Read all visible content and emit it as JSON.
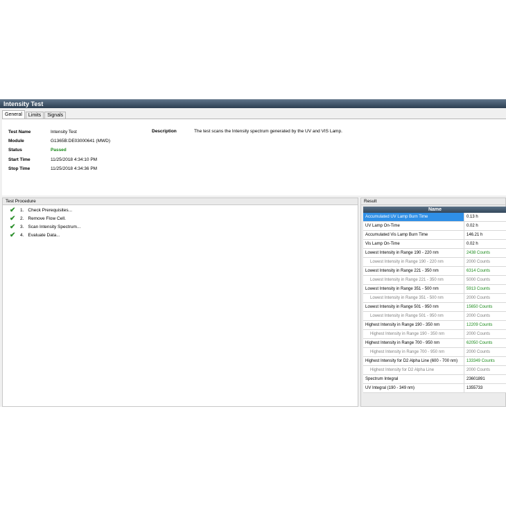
{
  "window": {
    "title": "Intensity Test"
  },
  "tabs": [
    "General",
    "Limits",
    "Signals"
  ],
  "info": {
    "test_name_label": "Test Name",
    "test_name": "Intensity Test",
    "module_label": "Module",
    "module": "G1365B:DE03000641 (MWD)",
    "status_label": "Status",
    "status": "Passed",
    "start_label": "Start Time",
    "start": "11/25/2018 4:34:10 PM",
    "stop_label": "Stop Time",
    "stop": "11/25/2018 4:34:36 PM",
    "description_label": "Description",
    "description": "The test scans the Intensity spectrum generated by the UV and VIS Lamp."
  },
  "procedure": {
    "header": "Test Procedure",
    "steps": [
      {
        "num": "1.",
        "label": "Check Prerequisites..."
      },
      {
        "num": "2.",
        "label": "Remove Flow Cell."
      },
      {
        "num": "3.",
        "label": "Scan Intensity Spectrum..."
      },
      {
        "num": "4.",
        "label": "Evaluate Data..."
      }
    ]
  },
  "result": {
    "header": "Result",
    "column": "Name",
    "rows": [
      {
        "name": "Accumulated UV Lamp Burn Time",
        "value": "0.13 h",
        "sel": true
      },
      {
        "name": "UV Lamp On-Time",
        "value": "0.02 h"
      },
      {
        "name": "Accumulated Vis Lamp Burn Time",
        "value": "146.21 h"
      },
      {
        "name": "Vis Lamp On-Time",
        "value": "0.02 h"
      },
      {
        "name": "Lowest Intensity in Range 190 - 220 nm",
        "value": "2438 Counts",
        "green": true
      },
      {
        "name": "Lowest Intensity in Range 190 - 220 nm",
        "value": "2000 Counts",
        "sub": true
      },
      {
        "name": "Lowest Intensity in Range 221 - 350 nm",
        "value": "6314 Counts",
        "green": true
      },
      {
        "name": "Lowest Intensity in Range 221 - 350 nm",
        "value": "5000 Counts",
        "sub": true
      },
      {
        "name": "Lowest Intensity in Range 351 - 500 nm",
        "value": "5913 Counts",
        "green": true
      },
      {
        "name": "Lowest Intensity in Range 351 - 500 nm",
        "value": "2000 Counts",
        "sub": true
      },
      {
        "name": "Lowest Intensity in Range 501 - 950 nm",
        "value": "15650 Counts",
        "green": true
      },
      {
        "name": "Lowest Intensity in Range 501 - 950 nm",
        "value": "2000 Counts",
        "sub": true
      },
      {
        "name": "Highest Intensity in Range 190 - 350 nm",
        "value": "12209 Counts",
        "green": true
      },
      {
        "name": "Highest Intensity in Range 190 - 350 nm",
        "value": "2000 Counts",
        "sub": true
      },
      {
        "name": "Highest Intensity in Range 700 - 950 nm",
        "value": "62050 Counts",
        "green": true
      },
      {
        "name": "Highest Intensity in Range 700 - 950 nm",
        "value": "2000 Counts",
        "sub": true
      },
      {
        "name": "Highest Intensity for D2 Alpha Line (600 - 700 nm)",
        "value": "133349 Counts",
        "green": true
      },
      {
        "name": "Highest Intensity for D2 Alpha Line",
        "value": "2000 Counts",
        "sub": true
      },
      {
        "name": "Spectrum Integral",
        "value": "23601891"
      },
      {
        "name": "UV Integral (190 - 349 nm)",
        "value": "1355733"
      }
    ]
  },
  "colors": {
    "title_bar": "#2d3f52",
    "selected": "#2f8fe6",
    "passed": "#1b8a1b"
  },
  "icons": {
    "step_status": "check-icon"
  }
}
